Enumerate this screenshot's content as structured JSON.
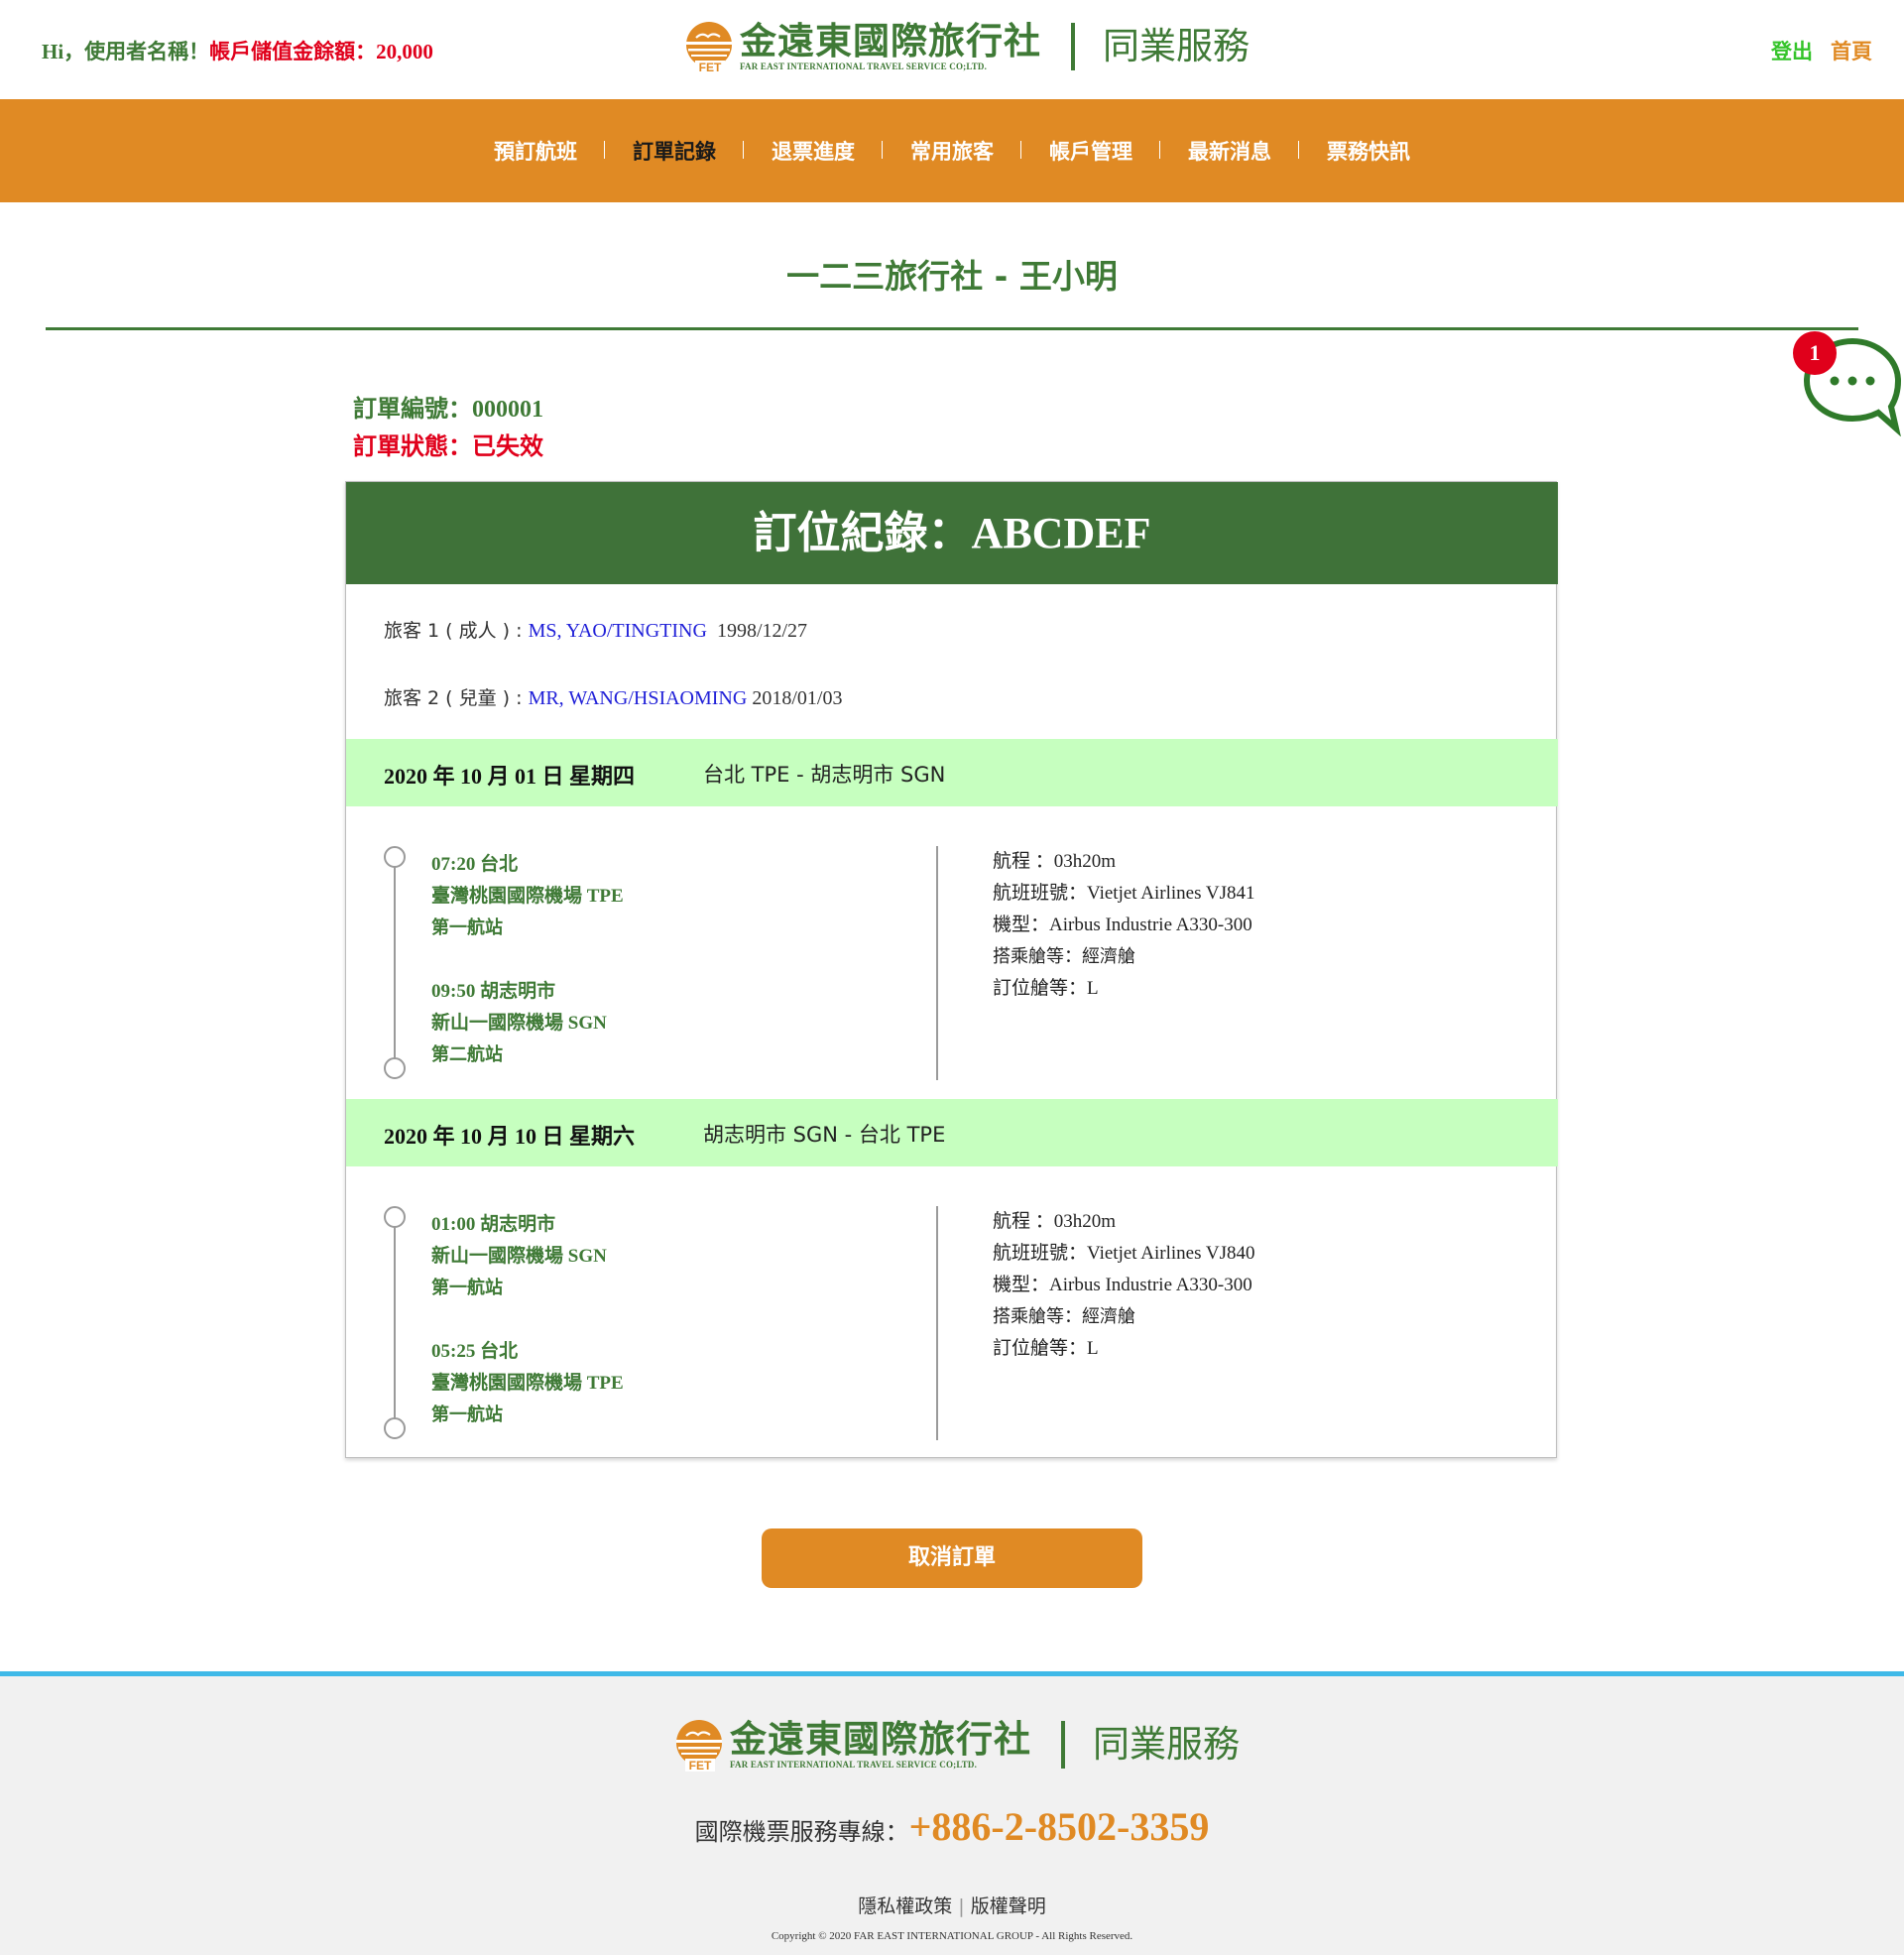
{
  "header": {
    "greeting_prefix": "Hi，使用者名稱！",
    "balance_text": "帳戶儲值金餘額：20,000",
    "logo_cn": "金遠東國際旅行社",
    "logo_en": "FAR EAST INTERNATIONAL TRAVEL SERVICE CO;LTD.",
    "logo_badge": "FET",
    "service_label": "同業服務",
    "logout_label": "登出",
    "home_label": "首頁"
  },
  "nav": {
    "items": [
      {
        "label": "預訂航班"
      },
      {
        "label": "訂單記錄"
      },
      {
        "label": "退票進度"
      },
      {
        "label": "常用旅客"
      },
      {
        "label": "帳戶管理"
      },
      {
        "label": "最新消息"
      },
      {
        "label": "票務快訊"
      }
    ],
    "active": "訂單記錄"
  },
  "page": {
    "title": "一二三旅行社 - 王小明"
  },
  "chat": {
    "badge_count": "1"
  },
  "order": {
    "number_label": "訂單編號：",
    "number_value": "000001",
    "status_text": "訂單狀態：已失效"
  },
  "booking": {
    "title": "訂位紀錄：ABCDEF",
    "passengers": [
      {
        "label": "旅客 1 ( 成人 ) : ",
        "name": "MS, YAO/TINGTING",
        "dob": "1998/12/27"
      },
      {
        "label": "旅客 2 ( 兒童 ) : ",
        "name": "MR, WANG/HSIAOMING",
        "dob": "2018/01/03"
      }
    ],
    "segments": [
      {
        "date": "2020 年 10 月 01 日 星期四",
        "route": "台北 TPE - 胡志明市 SGN",
        "depart": {
          "time_city": "07:20 台北",
          "airport": "臺灣桃園國際機場 TPE",
          "terminal": "第一航站"
        },
        "arrive": {
          "time_city": "09:50 胡志明市",
          "airport": "新山一國際機場 SGN",
          "terminal": "第二航站"
        },
        "duration": "航程 ：03h20m",
        "flight": "航班班號：Vietjet Airlines VJ841",
        "aircraft": "機型：Airbus Industrie A330-300",
        "cabin": "搭乘艙等：經濟艙",
        "booking_class": "訂位艙等：L"
      },
      {
        "date": "2020 年 10 月 10 日 星期六",
        "route": "胡志明市 SGN - 台北 TPE",
        "depart": {
          "time_city": "01:00 胡志明市",
          "airport": "新山一國際機場 SGN",
          "terminal": "第一航站"
        },
        "arrive": {
          "time_city": "05:25 台北",
          "airport": "臺灣桃園國際機場 TPE",
          "terminal": "第一航站"
        },
        "duration": "航程 ：03h20m",
        "flight": "航班班號：Vietjet Airlines VJ840",
        "aircraft": "機型：Airbus Industrie A330-300",
        "cabin": "搭乘艙等：經濟艙",
        "booking_class": "訂位艙等：L"
      }
    ]
  },
  "actions": {
    "cancel_label": "取消訂單"
  },
  "footer": {
    "hotline_label": "國際機票服務專線：",
    "hotline_number": "+886-2-8502-3359",
    "privacy_label": "隱私權政策",
    "copyright_label": "版權聲明",
    "copyright_text": "Copyright © 2020 FAR EAST INTERNATIONAL GROUP - All Rights Reserved."
  },
  "colors": {
    "brand_green": "#3f7a36",
    "brand_orange": "#e08a24",
    "alert_red": "#e0001b",
    "segment_band": "#c6ffbf",
    "footer_rule": "#3fb9e8"
  }
}
